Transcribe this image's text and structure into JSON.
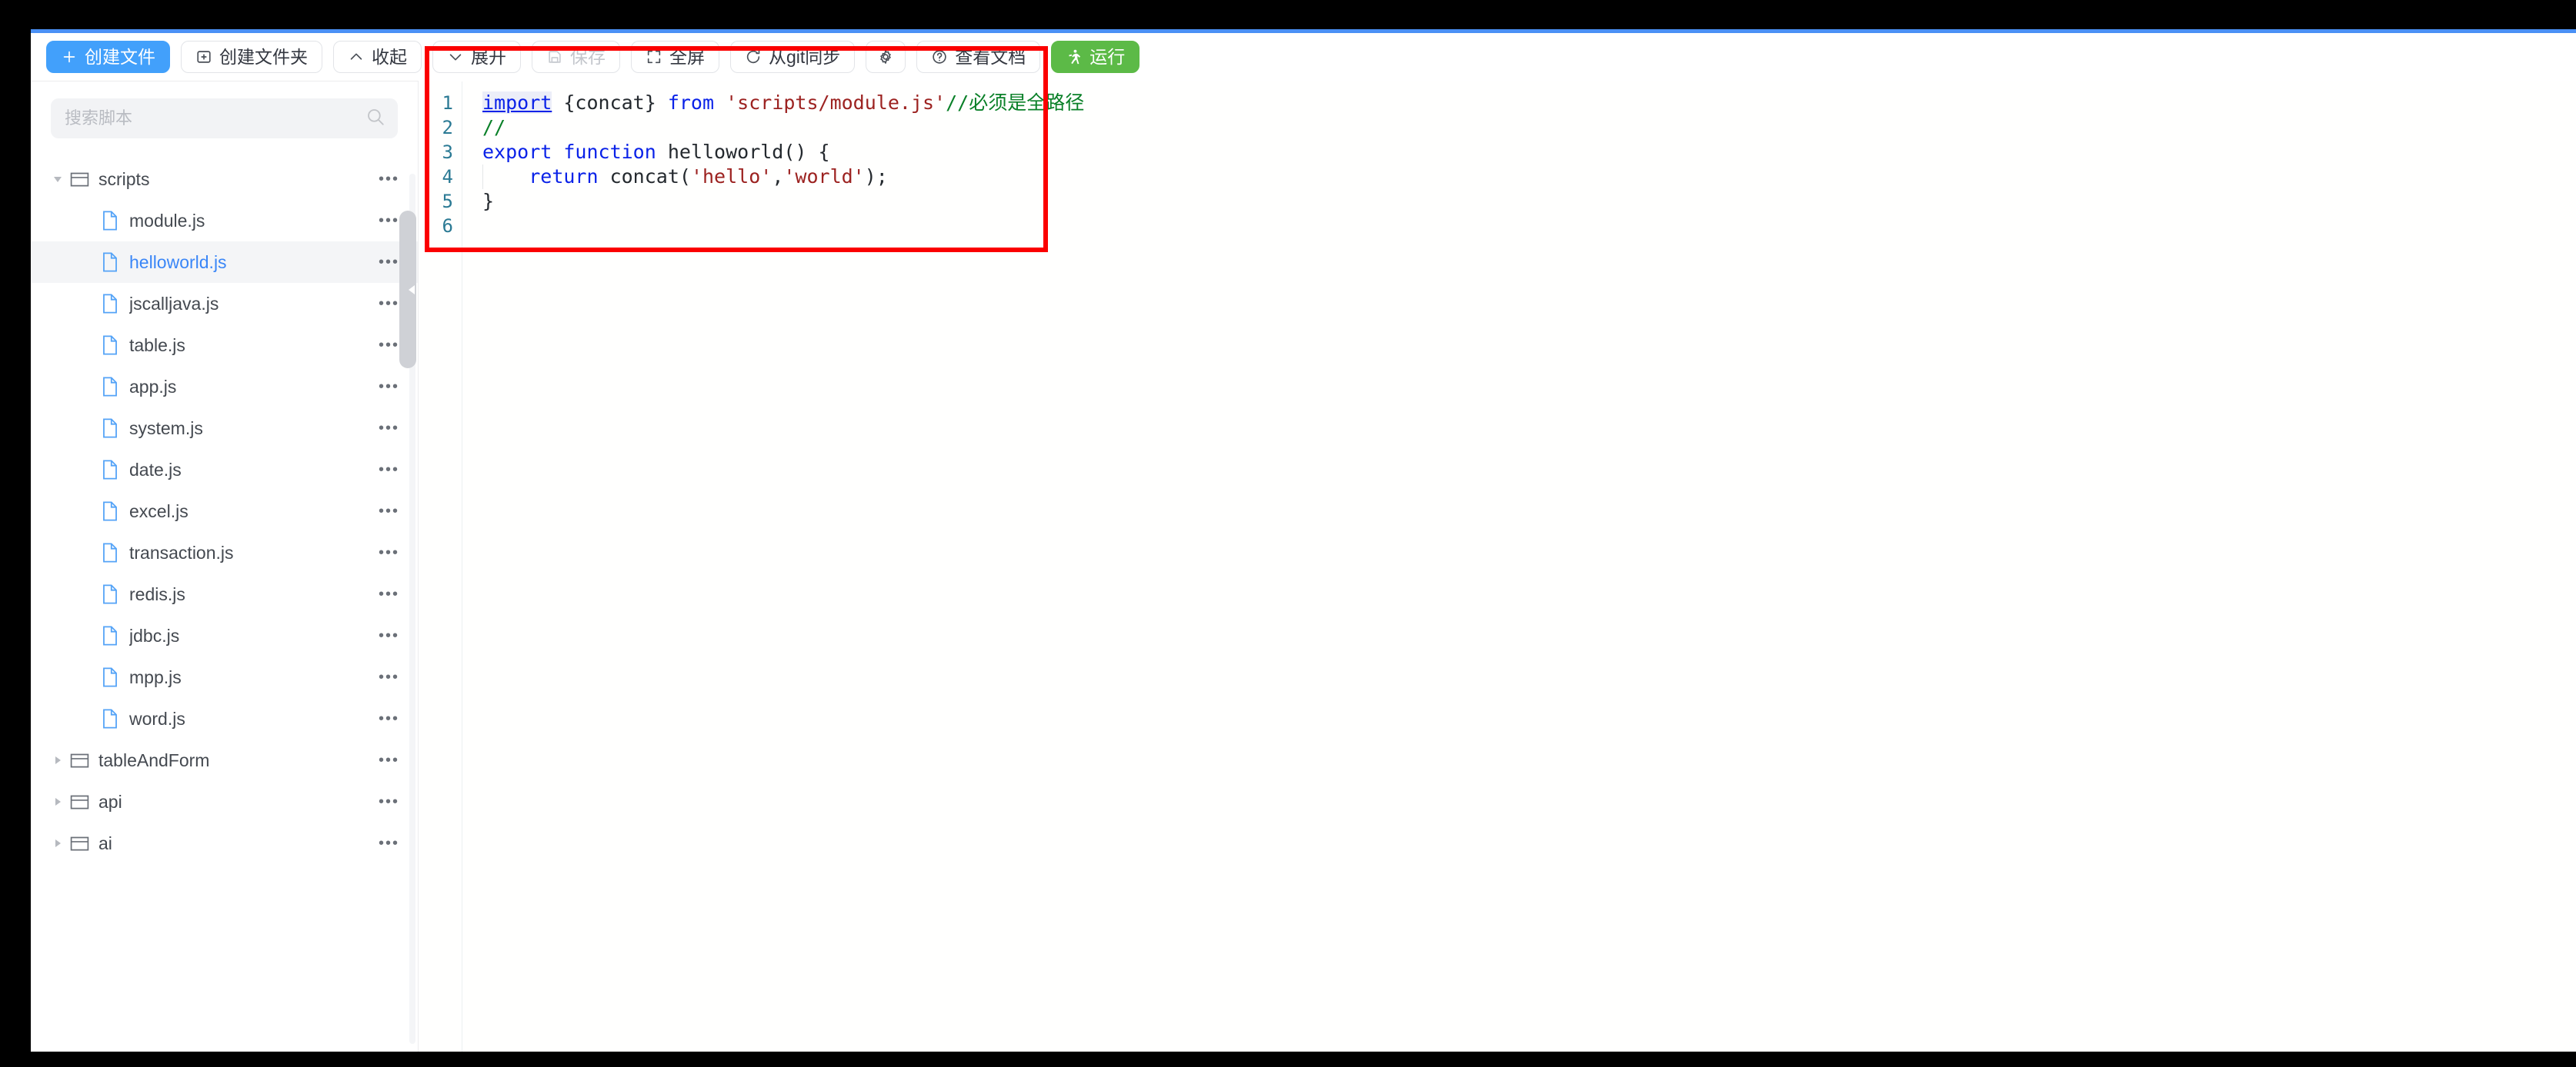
{
  "app": {
    "accent_primary": "#42a0fb",
    "accent_success": "#5cba47",
    "annotation_color": "#fb0000"
  },
  "toolbar": {
    "buttons": [
      {
        "label": "创建文件",
        "icon": "plus-icon",
        "style": "primary",
        "name": "create-file-button"
      },
      {
        "label": "创建文件夹",
        "icon": "folder-plus-icon",
        "style": "normal",
        "name": "create-folder-button"
      },
      {
        "label": "收起",
        "icon": "chevron-up-icon",
        "style": "normal",
        "name": "collapse-all-button"
      },
      {
        "label": "展开",
        "icon": "chevron-down-icon",
        "style": "normal",
        "name": "expand-all-button"
      },
      {
        "label": "保存",
        "icon": "save-icon",
        "style": "disabled",
        "name": "save-button"
      },
      {
        "label": "全屏",
        "icon": "fullscreen-icon",
        "style": "normal",
        "name": "fullscreen-button"
      },
      {
        "label": "从git同步",
        "icon": "refresh-icon",
        "style": "normal",
        "name": "git-sync-button"
      },
      {
        "label": "",
        "icon": "gear-icon",
        "style": "normal",
        "name": "settings-button"
      },
      {
        "label": "查看文档",
        "icon": "question-icon",
        "style": "normal",
        "name": "view-docs-button"
      },
      {
        "label": "运行",
        "icon": "run-icon",
        "style": "success",
        "name": "run-button"
      }
    ]
  },
  "sidebar": {
    "search": {
      "placeholder": "搜索脚本",
      "value": "",
      "icon": "search-icon"
    },
    "tree": [
      {
        "label": "scripts",
        "type": "folder",
        "depth": 0,
        "expanded": true,
        "selected": false
      },
      {
        "label": "module.js",
        "type": "file",
        "depth": 1,
        "expanded": false,
        "selected": false
      },
      {
        "label": "helloworld.js",
        "type": "file",
        "depth": 1,
        "expanded": false,
        "selected": true
      },
      {
        "label": "jscalljava.js",
        "type": "file",
        "depth": 1,
        "expanded": false,
        "selected": false
      },
      {
        "label": "table.js",
        "type": "file",
        "depth": 1,
        "expanded": false,
        "selected": false
      },
      {
        "label": "app.js",
        "type": "file",
        "depth": 1,
        "expanded": false,
        "selected": false
      },
      {
        "label": "system.js",
        "type": "file",
        "depth": 1,
        "expanded": false,
        "selected": false
      },
      {
        "label": "date.js",
        "type": "file",
        "depth": 1,
        "expanded": false,
        "selected": false
      },
      {
        "label": "excel.js",
        "type": "file",
        "depth": 1,
        "expanded": false,
        "selected": false
      },
      {
        "label": "transaction.js",
        "type": "file",
        "depth": 1,
        "expanded": false,
        "selected": false
      },
      {
        "label": "redis.js",
        "type": "file",
        "depth": 1,
        "expanded": false,
        "selected": false
      },
      {
        "label": "jdbc.js",
        "type": "file",
        "depth": 1,
        "expanded": false,
        "selected": false
      },
      {
        "label": "mpp.js",
        "type": "file",
        "depth": 1,
        "expanded": false,
        "selected": false
      },
      {
        "label": "word.js",
        "type": "file",
        "depth": 1,
        "expanded": false,
        "selected": false
      },
      {
        "label": "tableAndForm",
        "type": "folder",
        "depth": 0,
        "expanded": false,
        "selected": false
      },
      {
        "label": "api",
        "type": "folder",
        "depth": 0,
        "expanded": false,
        "selected": false
      },
      {
        "label": "ai",
        "type": "folder",
        "depth": 0,
        "expanded": false,
        "selected": false
      }
    ],
    "row_menu_glyph": "•••"
  },
  "editor": {
    "active_file": "helloworld.js",
    "line_numbers": [
      "1",
      "2",
      "3",
      "4",
      "5",
      "6"
    ],
    "lines": [
      {
        "n": "1",
        "tokens": [
          {
            "t": "import",
            "c": "kw-u"
          },
          {
            "t": " {concat} ",
            "c": "plain"
          },
          {
            "t": "from",
            "c": "kw"
          },
          {
            "t": " ",
            "c": "plain"
          },
          {
            "t": "'scripts/module.js'",
            "c": "str"
          },
          {
            "t": "//必须是全路径",
            "c": "cmt"
          }
        ]
      },
      {
        "n": "2",
        "tokens": [
          {
            "t": "//",
            "c": "cmt"
          }
        ]
      },
      {
        "n": "3",
        "tokens": [
          {
            "t": "export",
            "c": "kw"
          },
          {
            "t": " ",
            "c": "plain"
          },
          {
            "t": "function",
            "c": "kw"
          },
          {
            "t": " helloworld() {",
            "c": "plain"
          }
        ]
      },
      {
        "n": "4",
        "tokens": [
          {
            "t": "    ",
            "c": "plain"
          },
          {
            "t": "return",
            "c": "kw"
          },
          {
            "t": " concat(",
            "c": "plain"
          },
          {
            "t": "'hello'",
            "c": "str"
          },
          {
            "t": ",",
            "c": "plain"
          },
          {
            "t": "'world'",
            "c": "str"
          },
          {
            "t": ");",
            "c": "plain"
          }
        ]
      },
      {
        "n": "5",
        "tokens": [
          {
            "t": "}",
            "c": "plain"
          }
        ]
      },
      {
        "n": "6",
        "tokens": []
      }
    ]
  }
}
